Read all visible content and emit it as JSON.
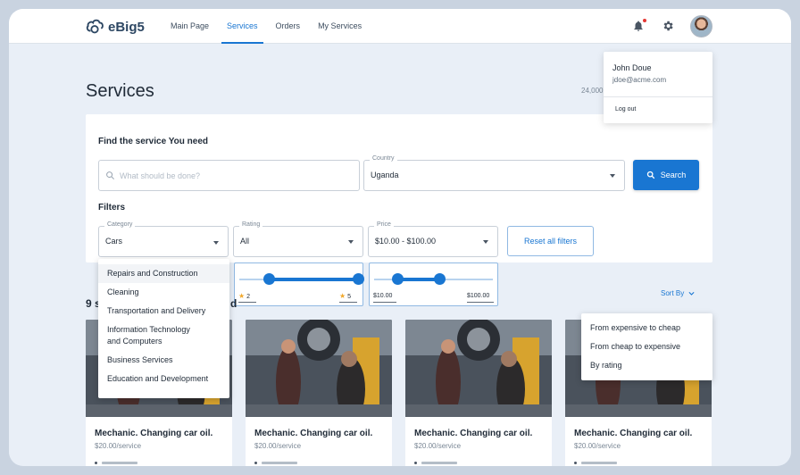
{
  "app": {
    "logo_text": "eBig5",
    "colors": {
      "accent": "#1976d2",
      "background": "#e9eff7",
      "notification": "#e53935",
      "star": "#f2a82b"
    }
  },
  "nav": {
    "items": [
      {
        "label": "Main Page"
      },
      {
        "label": "Services",
        "active": true
      },
      {
        "label": "Orders"
      },
      {
        "label": "My Services"
      }
    ]
  },
  "header_icons": {
    "notifications": "bell-icon",
    "settings": "gear-icon",
    "avatar": "avatar"
  },
  "user_menu": {
    "name": "John Doue",
    "email": "jdoe@acme.com",
    "logout_label": "Log out"
  },
  "page": {
    "title": "Services",
    "count_partial": "24,000"
  },
  "search": {
    "heading": "Find the service You need",
    "placeholder": "What should be done?",
    "country_label": "Country",
    "country_value": "Uganda",
    "button_label": "Search"
  },
  "filters": {
    "heading": "Filters",
    "category": {
      "label": "Category",
      "value": "Cars"
    },
    "rating": {
      "label": "Rating",
      "value": "All",
      "min": "2",
      "max": "5",
      "min_level": 0.25,
      "max_level": 1.0
    },
    "price": {
      "label": "Price",
      "value": "$10.00 - $100.00",
      "min": "$10.00",
      "max": "$100.00",
      "min_level": 0.2,
      "max_level": 0.55
    },
    "reset_label": "Reset all filters"
  },
  "category_options": [
    "Repairs and Construction",
    "Cleaning",
    "Transportation and Delivery",
    "Information Technology and Computers",
    "Business Services",
    "Education and Development"
  ],
  "results": {
    "count_text_visible": "9 s",
    "count_text_tail": "d",
    "sort_label": "Sort By",
    "sort_options": [
      "From expensive to cheap",
      "From cheap to expensive",
      "By rating"
    ]
  },
  "services": [
    {
      "title": "Mechanic. Changing car oil.",
      "price": "$20.00/service"
    },
    {
      "title": "Mechanic. Changing car oil.",
      "price": "$20.00/service"
    },
    {
      "title": "Mechanic. Changing car oil.",
      "price": "$20.00/service"
    },
    {
      "title": "Mechanic. Changing car oil.",
      "price": "$20.00/service"
    }
  ]
}
